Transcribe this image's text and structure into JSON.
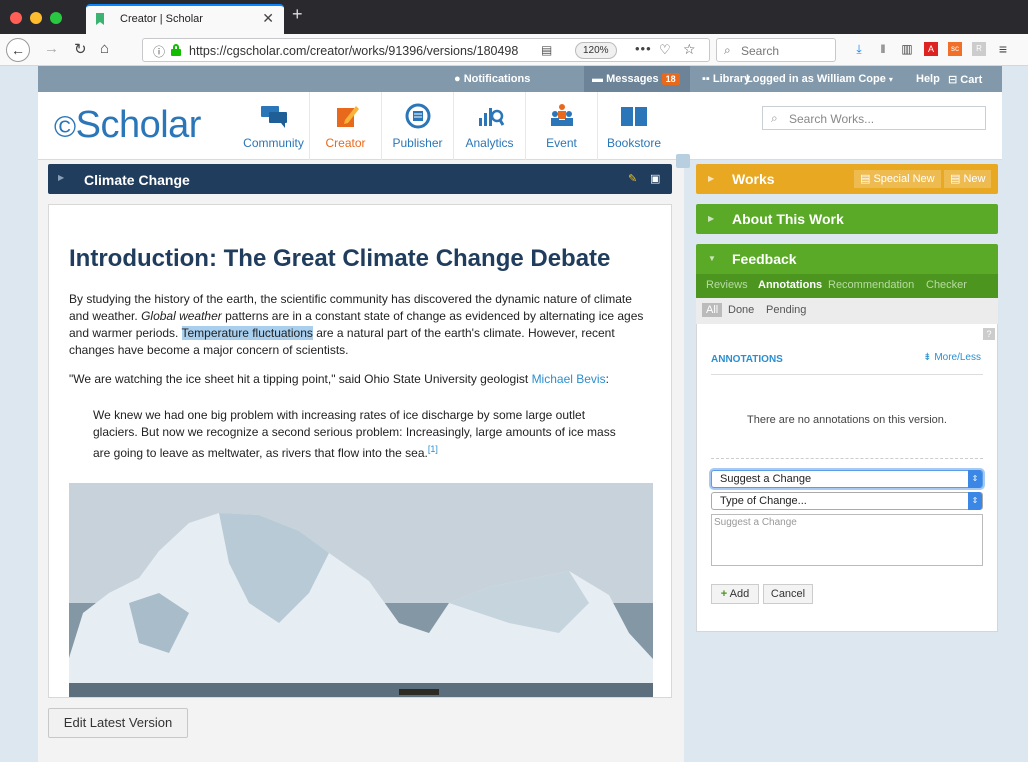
{
  "browser": {
    "tab_title": "Creator | Scholar",
    "url": "https://cgscholar.com/creator/works/91396/versions/180498",
    "zoom": "120%",
    "search_placeholder": "Search"
  },
  "topstrip": {
    "notifications": "Notifications",
    "messages": "Messages",
    "messages_count": "18",
    "library": "Library",
    "logged_in": "Logged in as William Cope",
    "help": "Help",
    "cart": "Cart"
  },
  "header": {
    "logo": "Scholar",
    "nav": [
      {
        "label": "Community",
        "icon": "community-icon"
      },
      {
        "label": "Creator",
        "icon": "creator-icon"
      },
      {
        "label": "Publisher",
        "icon": "publisher-icon"
      },
      {
        "label": "Analytics",
        "icon": "analytics-icon"
      },
      {
        "label": "Event",
        "icon": "event-icon"
      },
      {
        "label": "Bookstore",
        "icon": "bookstore-icon"
      }
    ],
    "search_placeholder": "Search Works..."
  },
  "work": {
    "title": "Climate Change",
    "heading": "Introduction: The Great Climate Change Debate",
    "p1_a": "By studying the history of the earth, the scientific community has discovered the dynamic nature of climate and weather. ",
    "p1_italic": "Global weather",
    "p1_b": " patterns are in a constant state of change as evidenced by alternating ice ages and warmer periods. ",
    "p1_highlight": "Temperature fluctuations",
    "p1_c": " are a natural part of the earth's climate. However, recent changes have become a major concern of scientists.",
    "p2_a": "\"We are watching the ice sheet hit a tipping point,\" said Ohio State University geologist ",
    "p2_link": "Michael Bevis",
    "p2_b": ":",
    "quote": "We knew we had one big problem with increasing rates of ice discharge by some large outlet glaciers. But now we recognize a second serious problem: Increasingly, large amounts of ice mass are going to leave as meltwater, as rivers that flow into the sea.",
    "footnote": "[1]",
    "edit_button": "Edit Latest Version"
  },
  "panel": {
    "works": "Works",
    "special_new": "Special New",
    "new": "New",
    "about": "About This Work",
    "feedback": "Feedback",
    "tabs": [
      "Reviews",
      "Annotations",
      "Recommendation",
      "Checker"
    ],
    "filters": [
      "All",
      "Done",
      "Pending"
    ],
    "help": "?",
    "annotations_title": "ANNOTATIONS",
    "more_less": "More/Less",
    "empty": "There are no annotations on this version.",
    "select1": "Suggest a Change",
    "select2": "Type of Change...",
    "textarea_placeholder": "Suggest a Change",
    "add": "Add",
    "cancel": "Cancel"
  },
  "colors": {
    "brand_blue": "#2a76b8",
    "creator_orange": "#e9691c",
    "works_yellow": "#e9a821",
    "feedback_green": "#5aaa28",
    "title_navy": "#203d5d"
  }
}
